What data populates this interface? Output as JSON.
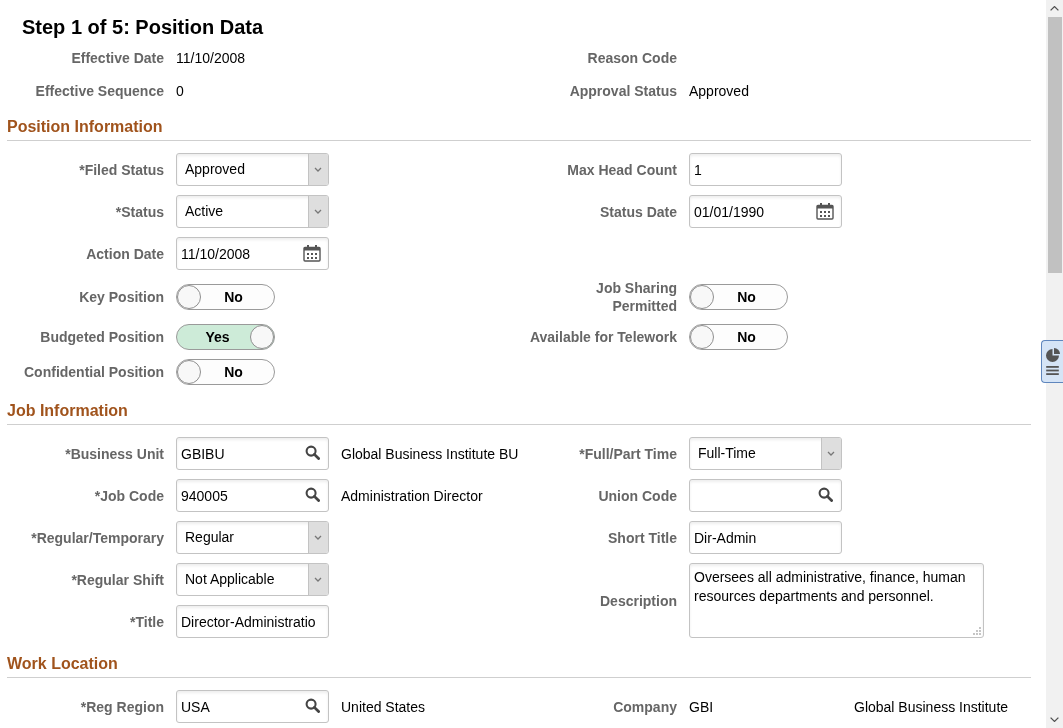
{
  "page": {
    "title": "Step 1 of 5: Position Data"
  },
  "summary": {
    "rows": [
      {
        "left": {
          "kind": "display",
          "label": "Effective Date",
          "value": "11/10/2008"
        },
        "right": {
          "kind": "display",
          "label": "Reason Code"
        }
      },
      {
        "left": {
          "kind": "display",
          "label": "Effective Sequence",
          "value": "0"
        },
        "right": {
          "kind": "display",
          "label": "Approval Status",
          "value": "Approved"
        }
      }
    ]
  },
  "sections": [
    {
      "title": "Position Information",
      "rows": [
        {
          "left": {
            "kind": "select",
            "label": "*Filed Status",
            "value": "Approved"
          },
          "right": {
            "kind": "text",
            "label": "Max Head Count",
            "value": "1"
          }
        },
        {
          "left": {
            "kind": "select",
            "label": "*Status",
            "value": "Active"
          },
          "right": {
            "kind": "date",
            "label": "Status Date",
            "value": "01/01/1990"
          }
        },
        {
          "left": {
            "kind": "date",
            "label": "Action Date",
            "value": "11/10/2008"
          }
        },
        {
          "left": {
            "kind": "toggle",
            "label": "Key Position",
            "on": false,
            "text": "No"
          },
          "right": {
            "kind": "toggle",
            "label": "Job Sharing\nPermitted",
            "on": false,
            "text": "No"
          }
        },
        {
          "left": {
            "kind": "toggle",
            "label": "Budgeted Position",
            "on": true,
            "text": "Yes"
          },
          "right": {
            "kind": "toggle",
            "label": "Available for Telework",
            "on": false,
            "text": "No"
          }
        },
        {
          "left": {
            "kind": "toggle",
            "label": "Confidential Position",
            "on": false,
            "text": "No"
          }
        }
      ]
    },
    {
      "title": "Job Information",
      "rows": [
        {
          "left": {
            "kind": "lookup",
            "label": "*Business Unit",
            "value": "GBIBU",
            "description": "Global Business Institute BU"
          },
          "right": {
            "kind": "select",
            "label": "*Full/Part Time",
            "value": "Full-Time"
          }
        },
        {
          "left": {
            "kind": "lookup",
            "label": "*Job Code",
            "value": "940005",
            "description": "Administration Director"
          },
          "right": {
            "kind": "lookup",
            "label": "Union Code"
          }
        },
        {
          "left": {
            "kind": "select",
            "label": "*Regular/Temporary",
            "value": "Regular"
          },
          "right": {
            "kind": "text",
            "label": "Short Title",
            "value": "Dir-Admin"
          }
        },
        {
          "left": {
            "kind": "select",
            "label": "*Regular Shift",
            "value": "Not Applicable"
          },
          "right": {
            "kind": "textarea",
            "label": "Description",
            "value": "Oversees all administrative, finance, human resources departments and personnel."
          }
        },
        {
          "left": {
            "kind": "text",
            "label": "*Title",
            "value": "Director-Administratio"
          }
        }
      ]
    },
    {
      "title": "Work Location",
      "rows": [
        {
          "left": {
            "kind": "lookup",
            "label": "*Reg Region",
            "value": "USA",
            "description": "United States"
          },
          "right": {
            "kind": "display",
            "label": "Company",
            "value": "GBI",
            "description": "Global Business Institute"
          }
        }
      ]
    }
  ]
}
